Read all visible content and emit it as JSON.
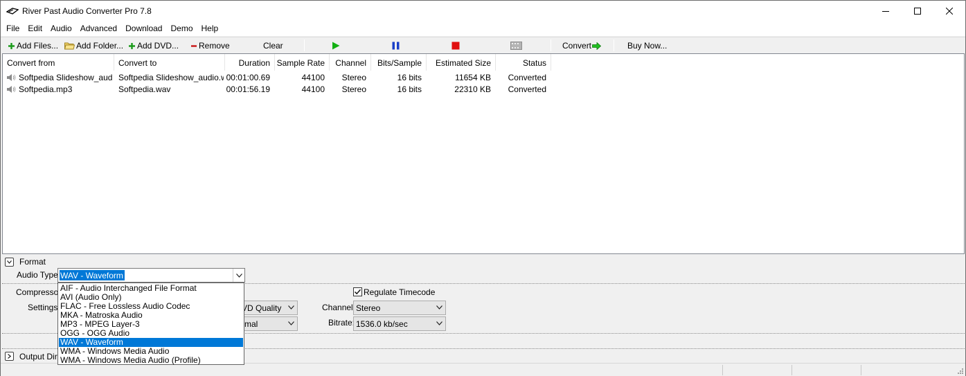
{
  "window": {
    "title": "River Past Audio Converter Pro 7.8"
  },
  "menu": [
    "File",
    "Edit",
    "Audio",
    "Advanced",
    "Download",
    "Demo",
    "Help"
  ],
  "toolbar": {
    "add_files": "Add Files...",
    "add_folder": "Add Folder...",
    "add_dvd": "Add DVD...",
    "remove": "Remove",
    "clear": "Clear",
    "convert": "Convert",
    "buy_now": "Buy Now..."
  },
  "table": {
    "columns": [
      "Convert from",
      "Convert to",
      "Duration",
      "Sample Rate",
      "Channel",
      "Bits/Sample",
      "Estimated Size",
      "Status"
    ],
    "rows": [
      [
        "Softpedia Slideshow_audi...",
        "Softpedia Slideshow_audio.w...",
        "00:01:00.69",
        "44100",
        "Stereo",
        "16 bits",
        "11654 KB",
        "Converted"
      ],
      [
        "Softpedia.mp3",
        "Softpedia.wav",
        "00:01:56.19",
        "44100",
        "Stereo",
        "16 bits",
        "22310 KB",
        "Converted"
      ]
    ]
  },
  "format": {
    "section_label": "Format",
    "audio_type_label": "Audio Type:",
    "audio_type_value": "WAV - Waveform",
    "compressor_label": "Compressor:",
    "settings_label": "Settings:",
    "settings_value_1": "VD Quality",
    "settings_value_2": "rmal",
    "regulate_timecode_label": "Regulate Timecode",
    "regulate_timecode_checked": true,
    "channel_label": "Channel:",
    "channel_value": "Stereo",
    "bitrate_label": "Bitrate:",
    "bitrate_value": "1536.0 kb/sec",
    "output_label": "Output Dire",
    "audio_type_options": [
      "AIF - Audio Interchanged File Format",
      "AVI (Audio Only)",
      "FLAC - Free Lossless Audio Codec",
      "MKA - Matroska Audio",
      "MP3 - MPEG Layer-3",
      "OGG - OGG Audio",
      "WAV - Waveform",
      "WMA - Windows Media Audio",
      "WMA - Windows Media Audio (Profile)"
    ],
    "selected_option": "WAV - Waveform"
  },
  "colors": {
    "selection": "#0078d7",
    "play": "#13b013",
    "pause": "#1a3fc8",
    "stop": "#e01010"
  }
}
